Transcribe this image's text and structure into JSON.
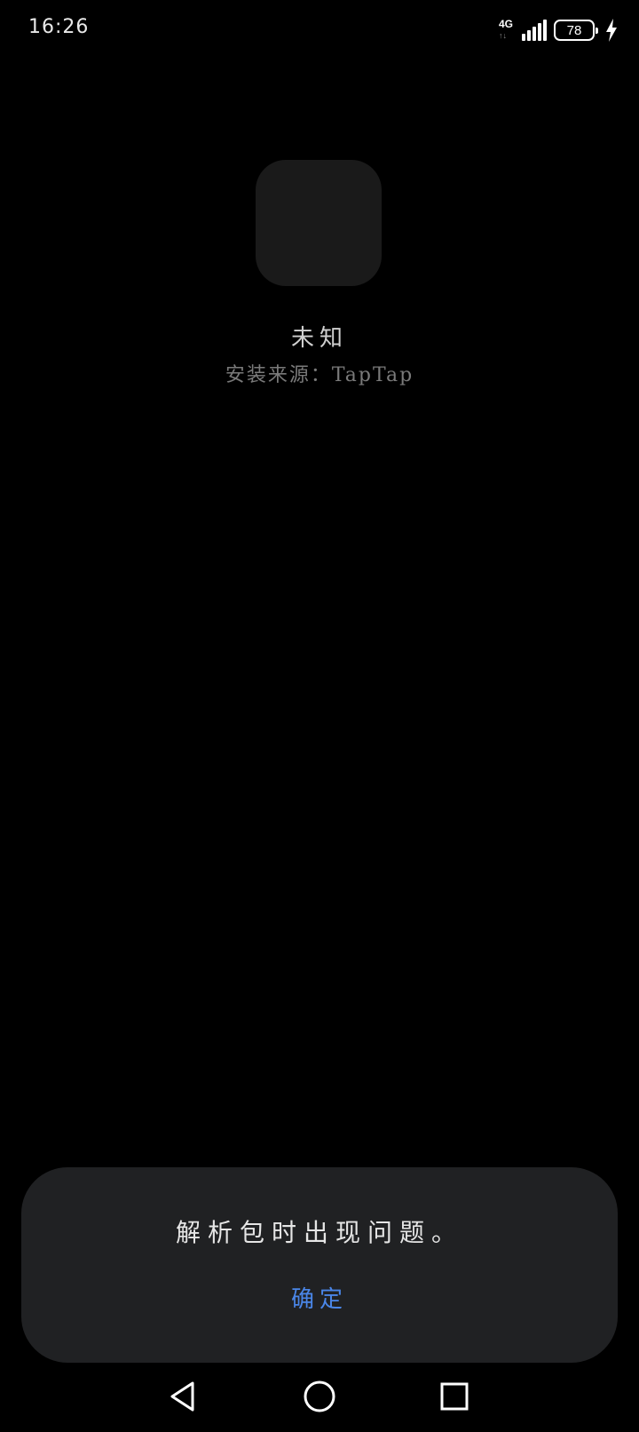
{
  "status_bar": {
    "time": "16:26",
    "network_type": "4G",
    "network_activity": "↑↓",
    "battery_level": "78",
    "signal_icon": "signal-bars-icon",
    "charging_icon": "lightning-bolt-icon"
  },
  "app": {
    "name": "未知",
    "install_source": "安装来源：TapTap"
  },
  "dialog": {
    "message": "解析包时出现问题。",
    "confirm_label": "确定",
    "accent_color": "#4a86e8",
    "background_color": "#202123"
  },
  "nav_bar": {
    "back_icon": "triangle-back-icon",
    "home_icon": "circle-home-icon",
    "recents_icon": "square-recents-icon"
  }
}
